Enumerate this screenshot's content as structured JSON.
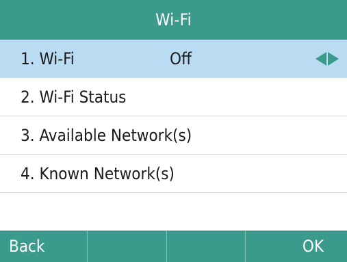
{
  "title": "Wi-Fi",
  "colors": {
    "header": "#3a9a8c",
    "selected_row": "#b9dcf3",
    "arrow": "#3a9a8c"
  },
  "menu": {
    "items": [
      {
        "label": "1. Wi-Fi",
        "value": "Off",
        "icons": [
          "left-arrow-icon",
          "right-arrow-icon"
        ]
      },
      {
        "label": "2. Wi-Fi Status"
      },
      {
        "label": "3. Available Network(s)"
      },
      {
        "label": "4. Known Network(s)"
      }
    ]
  },
  "softkeys": {
    "left": "Back",
    "right": "OK"
  }
}
